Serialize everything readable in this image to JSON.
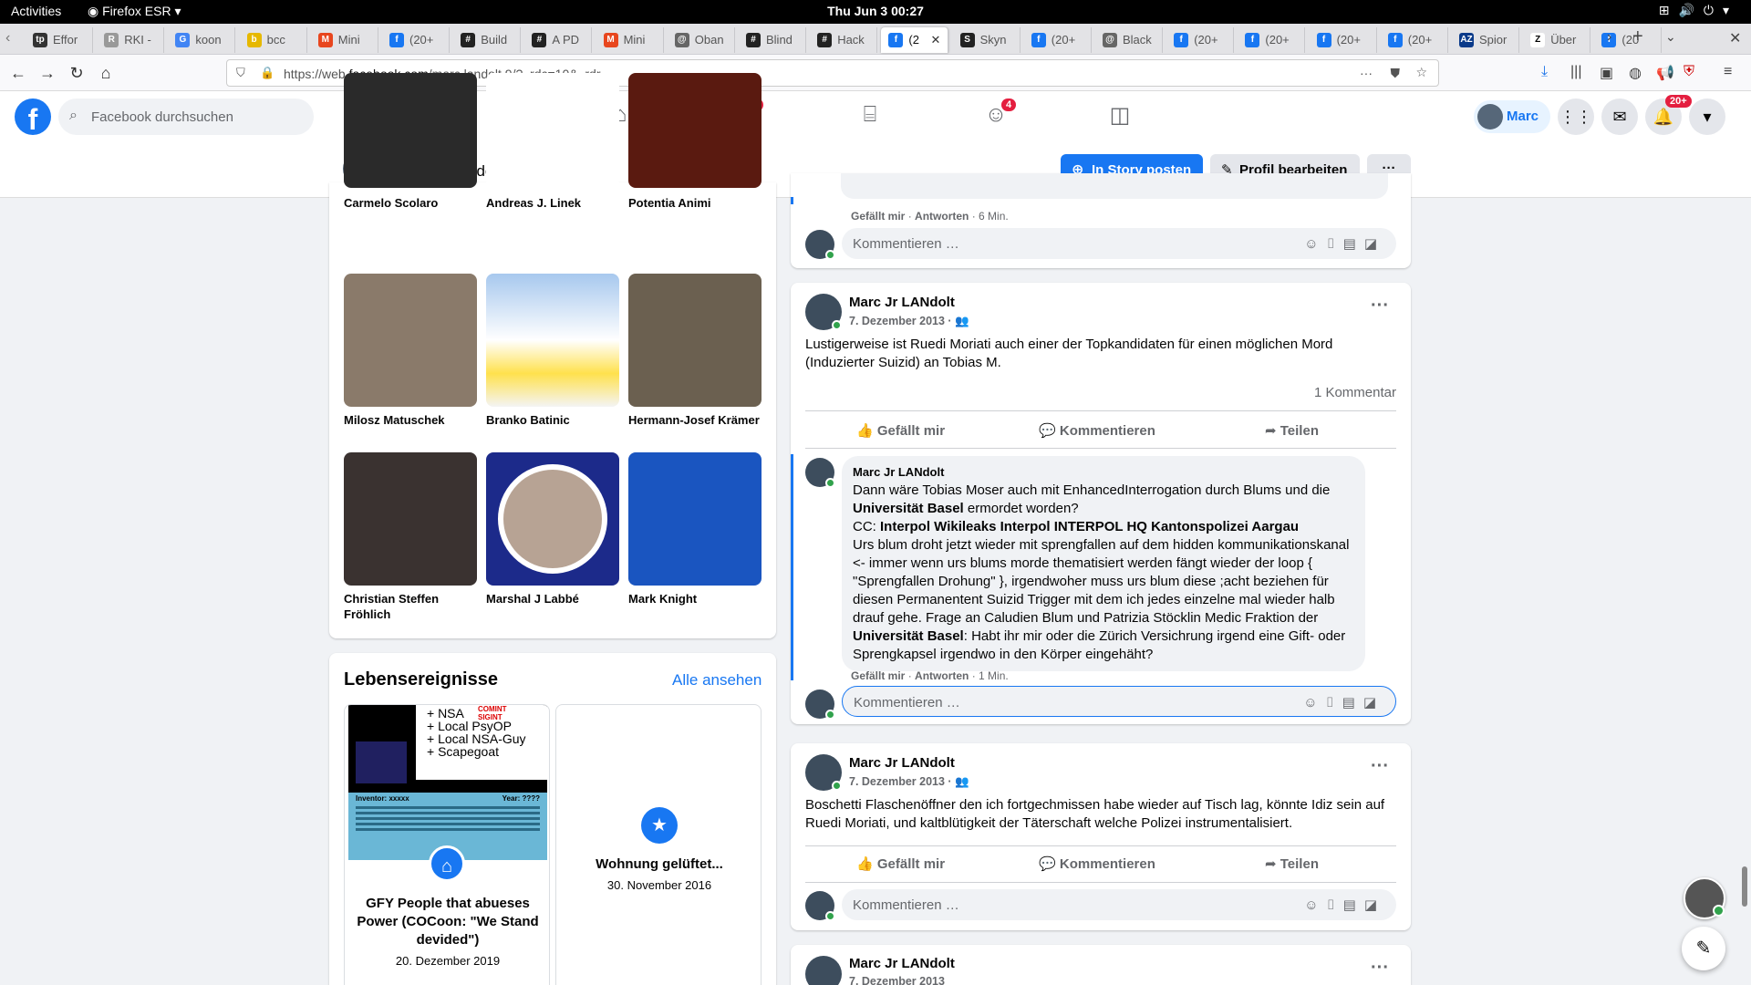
{
  "gnome": {
    "activities": "Activities",
    "app": "Firefox ESR ▾",
    "clock": "Thu Jun 3  00:27"
  },
  "tabs": [
    {
      "label": "Effor",
      "color": "#333",
      "glyph": "tp"
    },
    {
      "label": "RKI -",
      "color": "#999",
      "glyph": "R"
    },
    {
      "label": "koon",
      "color": "#4285f4",
      "glyph": "G"
    },
    {
      "label": "bcc",
      "color": "#e6b800",
      "glyph": "b"
    },
    {
      "label": "Mini",
      "color": "#e8461e",
      "glyph": "M"
    },
    {
      "label": "(20+",
      "color": "#1877f2",
      "glyph": "f"
    },
    {
      "label": "Build",
      "color": "#222",
      "glyph": "#"
    },
    {
      "label": "A PD",
      "color": "#222",
      "glyph": "#"
    },
    {
      "label": "Mini",
      "color": "#e8461e",
      "glyph": "M"
    },
    {
      "label": "Oban",
      "color": "#666",
      "glyph": "@"
    },
    {
      "label": "Blind",
      "color": "#222",
      "glyph": "#"
    },
    {
      "label": "Hack",
      "color": "#222",
      "glyph": "#"
    },
    {
      "label": "(2",
      "color": "#1877f2",
      "glyph": "f"
    },
    {
      "label": "Skyn",
      "color": "#222",
      "glyph": "S"
    },
    {
      "label": "(20+",
      "color": "#1877f2",
      "glyph": "f"
    },
    {
      "label": "Black",
      "color": "#666",
      "glyph": "@"
    },
    {
      "label": "(20+",
      "color": "#1877f2",
      "glyph": "f"
    },
    {
      "label": "(20+",
      "color": "#1877f2",
      "glyph": "f"
    },
    {
      "label": "(20+",
      "color": "#1877f2",
      "glyph": "f"
    },
    {
      "label": "(20+",
      "color": "#1877f2",
      "glyph": "f"
    },
    {
      "label": "Spior",
      "color": "#0a3a8a",
      "glyph": "AZ"
    },
    {
      "label": "Über",
      "color": "#fff",
      "glyph": "Z"
    },
    {
      "label": "(20",
      "color": "#1877f2",
      "glyph": "f"
    }
  ],
  "url": {
    "prefix": "https://web.",
    "domain": "facebook.com",
    "path": "/marc.landolt.9/?_rdc=10&_rdr"
  },
  "fb": {
    "search_placeholder": "Facebook durchsuchen",
    "watch_badge": "8",
    "groups_badge": "4",
    "notif_badge": "20+",
    "profile_name": "Marc"
  },
  "profilebar": {
    "name": "Marc Jr LANdolt",
    "story_btn": "In Story posten",
    "edit_btn": "Profil bearbeiten",
    "more_btn": "···"
  },
  "friends": [
    {
      "name": "Carmelo Scolaro",
      "color": "#2a2a2a"
    },
    {
      "name": "Andreas J. Linek",
      "color": "#ffffff"
    },
    {
      "name": "Potentia Animi",
      "color": "#5a1a10"
    },
    {
      "name": "Milosz Matuschek",
      "color": "#8a7a6a"
    },
    {
      "name": "Branko Batinic",
      "color": "#6aa0d8"
    },
    {
      "name": "Hermann-Josef Krämer",
      "color": "#6b6050"
    },
    {
      "name": "Christian Steffen Fröhlich",
      "color": "#3a3230"
    },
    {
      "name": "Marshal J Labbé",
      "color": "#1c2a8a"
    },
    {
      "name": "Mark Knight",
      "color": "#1a55c0"
    }
  ],
  "life_events": {
    "title": "Lebensereignisse",
    "see_all": "Alle ansehen",
    "items": [
      {
        "title": "GFY People that abueses Power (COCoon: \"We Stand devided\")",
        "date": "20. Dezember 2019",
        "img_lines": [
          "+ NSA",
          "+ Local PsyOP",
          "+ Local NSA-Guy",
          "+ Scapegoat"
        ],
        "img_tags": [
          "COMINT",
          "SIGINT"
        ],
        "img_small": [
          "Inventor: xxxxx",
          "Year: ????"
        ]
      },
      {
        "title": "Wohnung gelüftet...",
        "date": "30. November 2016"
      }
    ]
  },
  "common": {
    "like": "Gefällt mir",
    "comment": "Kommentieren",
    "share": "Teilen",
    "reply": "Antworten",
    "comment_placeholder": "Kommentieren …",
    "more": "···"
  },
  "top_fragment": {
    "meta_time": "6 Min."
  },
  "posts": [
    {
      "author": "Marc Jr LANdolt",
      "date": "7. Dezember 2013",
      "text": "Lustigerweise ist Ruedi Moriati auch einer der Topkandidaten für einen möglichen Mord (Induzierter Suizid) an Tobias M.",
      "comment_count": "1 Kommentar",
      "comment": {
        "author": "Marc Jr LANdolt",
        "time": "1 Min.",
        "html_parts": [
          "Dann wäre Tobias Moser auch mit EnhancedInterrogation durch Blums und die ",
          "Universität Basel",
          " ermordet worden?\nCC: ",
          "Interpol Wikileaks Interpol INTERPOL HQ Kantonspolizei Aargau",
          "\nUrs blum droht jetzt wieder mit sprengfallen auf dem hidden kommunikationskanal <- immer wenn urs blums morde thematisiert werden fängt wieder der loop { \"Sprengfallen Drohung\" }, irgendwoher muss urs blum diese ;acht beziehen für diesen Permanentent Suizid Trigger mit dem ich jedes einzelne mal wieder halb drauf gehe. Frage an Caludien Blum und Patrizia Stöcklin Medic Fraktion der ",
          "Universität Basel",
          ": Habt ihr mir oder die Zürich Versichrung irgend eine Gift- oder Sprengkapsel irgendwo in den Körper eingehäht?"
        ]
      }
    },
    {
      "author": "Marc Jr LANdolt",
      "date": "7. Dezember 2013",
      "text": "Boschetti Flaschenöffner den ich fortgechmissen habe wieder auf Tisch lag, könnte  Idiz sein auf Ruedi Moriati, und kaltblütigkeit der Täterschaft welche Polizei instrumentalisiert."
    },
    {
      "author": "Marc Jr LANdolt",
      "date": "7. Dezember 2013"
    }
  ]
}
